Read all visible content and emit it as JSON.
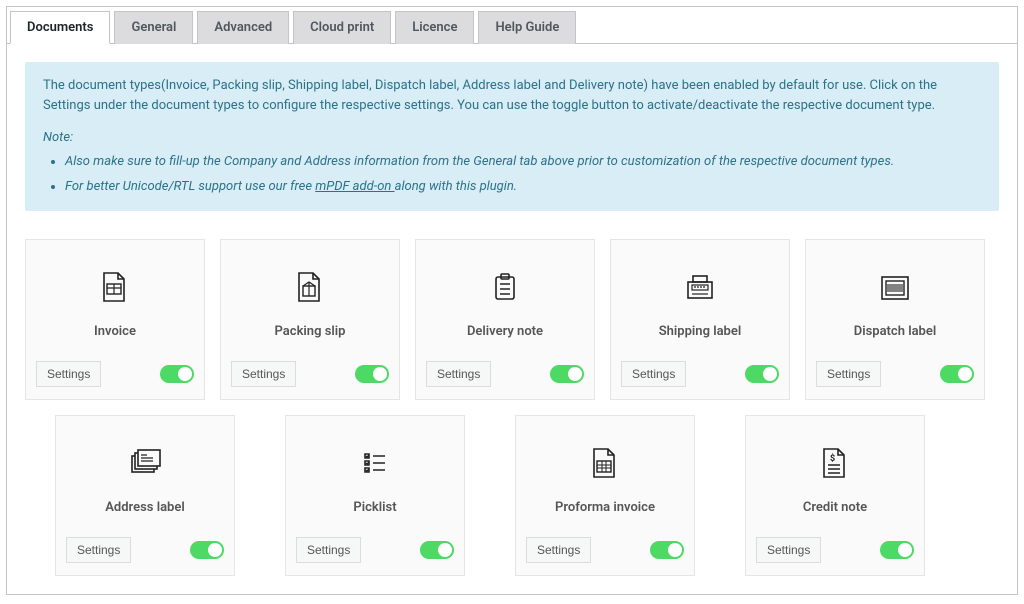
{
  "tabs": [
    {
      "label": "Documents",
      "active": true
    },
    {
      "label": "General",
      "active": false
    },
    {
      "label": "Advanced",
      "active": false
    },
    {
      "label": "Cloud print",
      "active": false
    },
    {
      "label": "Licence",
      "active": false
    },
    {
      "label": "Help Guide",
      "active": false
    }
  ],
  "infobox": {
    "para": "The document types(Invoice, Packing slip, Shipping label, Dispatch label, Address label and Delivery note) have been enabled by default for use. Click on the Settings under the document types to configure the respective settings. You can use the toggle button to activate/deactivate the respective document type.",
    "note_label": "Note:",
    "note1_a": "Also make sure to fill-up the Company and Address information from the General tab above prior to customization of the respective document types.",
    "note2_a": "For better Unicode/RTL support use our free ",
    "note2_link": "mPDF add-on ",
    "note2_b": "along with this plugin."
  },
  "settings_label": "Settings",
  "cards_row1": [
    {
      "title": "Invoice",
      "icon": "invoice",
      "enabled": true
    },
    {
      "title": "Packing slip",
      "icon": "packingslip",
      "enabled": true
    },
    {
      "title": "Delivery note",
      "icon": "deliverynote",
      "enabled": true
    },
    {
      "title": "Shipping label",
      "icon": "shippinglabel",
      "enabled": true
    },
    {
      "title": "Dispatch label",
      "icon": "dispatchlabel",
      "enabled": true
    }
  ],
  "cards_row2": [
    {
      "title": "Address label",
      "icon": "addresslabel",
      "enabled": true
    },
    {
      "title": "Picklist",
      "icon": "picklist",
      "enabled": true
    },
    {
      "title": "Proforma invoice",
      "icon": "proforma",
      "enabled": true
    },
    {
      "title": "Credit note",
      "icon": "creditnote",
      "enabled": true
    }
  ]
}
